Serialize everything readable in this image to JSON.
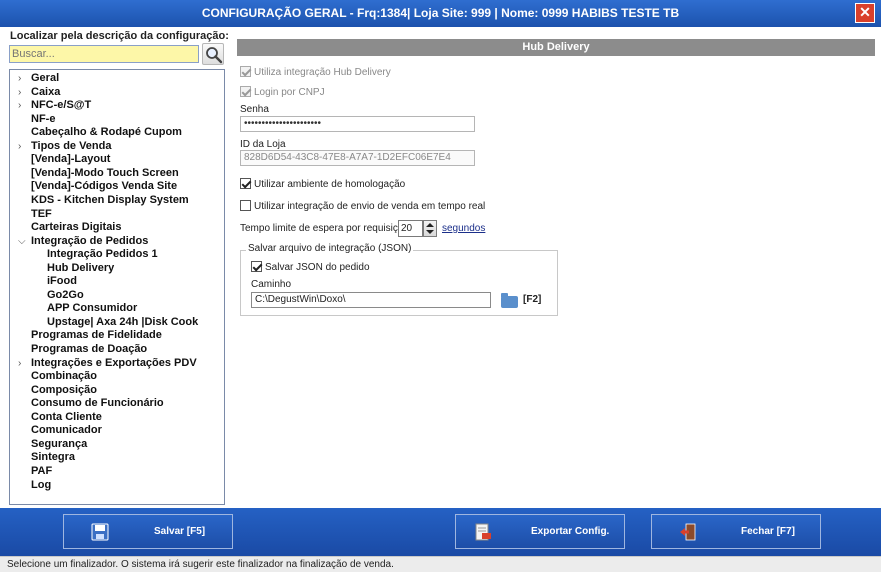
{
  "window": {
    "title": "CONFIGURAÇÃO GERAL - Frq:1384| Loja Site: 999 | Nome: 0999 HABIBS TESTE TB",
    "close_glyph": "✕"
  },
  "search": {
    "title": "Localizar pela descrição da configuração:",
    "placeholder": "Buscar...",
    "icon": "magnifier-icon"
  },
  "tree": [
    {
      "label": "Geral",
      "level": 0,
      "expandable": true
    },
    {
      "label": "Caixa",
      "level": 0,
      "expandable": true
    },
    {
      "label": "NFC-e/S@T",
      "level": 0,
      "expandable": true
    },
    {
      "label": "NF-e",
      "level": 0,
      "expandable": false
    },
    {
      "label": "Cabeçalho & Rodapé Cupom",
      "level": 0,
      "expandable": false
    },
    {
      "label": "Tipos de Venda",
      "level": 0,
      "expandable": true
    },
    {
      "label": "[Venda]-Layout",
      "level": 0,
      "expandable": false
    },
    {
      "label": "[Venda]-Modo Touch Screen",
      "level": 0,
      "expandable": false
    },
    {
      "label": "[Venda]-Códigos Venda Site",
      "level": 0,
      "expandable": false
    },
    {
      "label": "KDS - Kitchen Display System",
      "level": 0,
      "expandable": false
    },
    {
      "label": "TEF",
      "level": 0,
      "expandable": false
    },
    {
      "label": "Carteiras Digitais",
      "level": 0,
      "expandable": false
    },
    {
      "label": "Integração de Pedidos",
      "level": 0,
      "expandable": true,
      "expanded": true
    },
    {
      "label": "Integração Pedidos 1",
      "level": 1,
      "expandable": false
    },
    {
      "label": "Hub Delivery",
      "level": 1,
      "expandable": false,
      "selected": true
    },
    {
      "label": "iFood",
      "level": 1,
      "expandable": false
    },
    {
      "label": "Go2Go",
      "level": 1,
      "expandable": false
    },
    {
      "label": "APP Consumidor",
      "level": 1,
      "expandable": false
    },
    {
      "label": "Upstage| Axa 24h |Disk Cook",
      "level": 1,
      "expandable": false
    },
    {
      "label": "Programas de Fidelidade",
      "level": 0,
      "expandable": false
    },
    {
      "label": "Programas de Doação",
      "level": 0,
      "expandable": false
    },
    {
      "label": "Integrações e Exportações PDV",
      "level": 0,
      "expandable": true
    },
    {
      "label": "Combinação",
      "level": 0,
      "expandable": false
    },
    {
      "label": "Composição",
      "level": 0,
      "expandable": false
    },
    {
      "label": "Consumo de Funcionário",
      "level": 0,
      "expandable": false
    },
    {
      "label": "Conta Cliente",
      "level": 0,
      "expandable": false
    },
    {
      "label": "Comunicador",
      "level": 0,
      "expandable": false
    },
    {
      "label": "Segurança",
      "level": 0,
      "expandable": false
    },
    {
      "label": "Sintegra",
      "level": 0,
      "expandable": false
    },
    {
      "label": "PAF",
      "level": 0,
      "expandable": false
    },
    {
      "label": "Log",
      "level": 0,
      "expandable": false
    }
  ],
  "panel": {
    "header": "Hub Delivery",
    "use_hub": {
      "label": "Utiliza integração Hub Delivery",
      "checked": true,
      "enabled": false
    },
    "login_cnpj": {
      "label": "Login por CNPJ",
      "checked": true,
      "enabled": false
    },
    "senha": {
      "label": "Senha",
      "value": "••••••••••••••••••••••"
    },
    "id_loja": {
      "label": "ID da Loja",
      "value": "828D6D54-43C8-47E8-A7A7-1D2EFC06E7E4"
    },
    "homologacao": {
      "label": "Utilizar ambiente de homologação",
      "checked": true
    },
    "tempo_real": {
      "label": "Utilizar integração de envio de venda em tempo real",
      "checked": false
    },
    "timeout": {
      "label": "Tempo limite de espera por requisição",
      "value": "20",
      "unit": "segundos"
    },
    "json_group": {
      "title": "Salvar arquivo de integração (JSON)",
      "save_json": {
        "label": "Salvar JSON do pedido",
        "checked": true
      },
      "path_label": "Caminho",
      "path_value": "C:\\DegustWin\\Doxo\\",
      "shortcut": "[F2]"
    }
  },
  "buttons": {
    "save": "Salvar [F5]",
    "export": "Exportar Config.",
    "close": "Fechar [F7]"
  },
  "status": "Selecione um finalizador. O sistema irá sugerir este finalizador na finalização de venda.",
  "colors": {
    "titlebar": "#2f6ed0",
    "bottombar": "#2561c4",
    "search_bg": "#fdf7a8",
    "header_bg": "#8c8c8c",
    "close_red": "#d9402b"
  }
}
